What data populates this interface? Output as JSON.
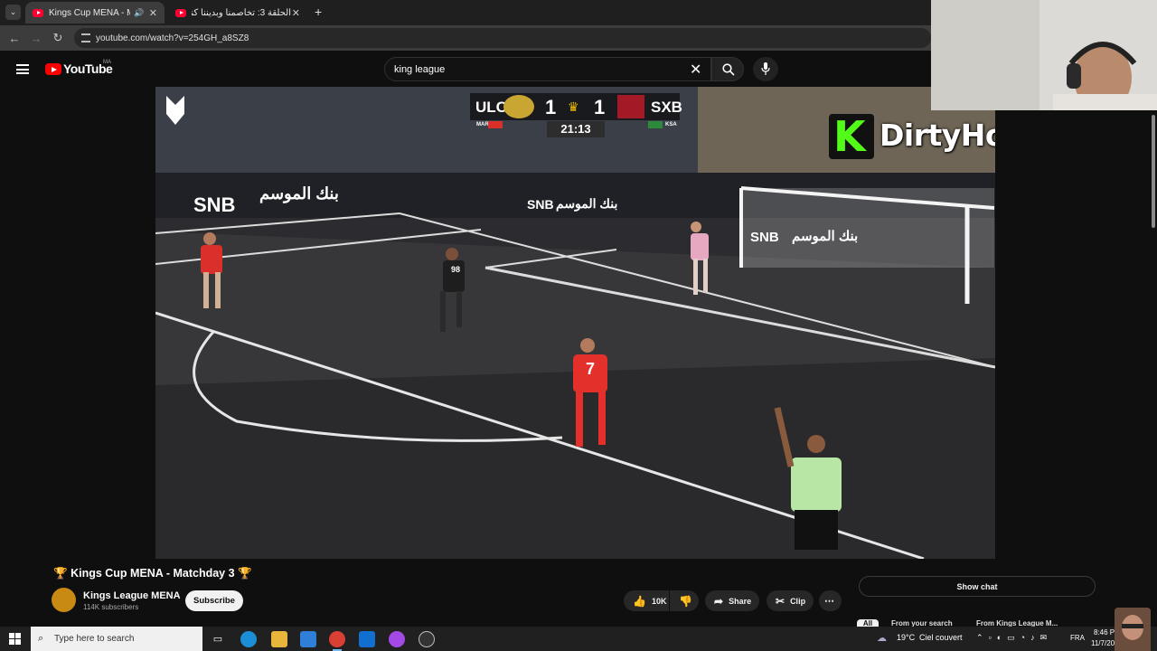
{
  "browser": {
    "tabs": [
      {
        "title": "Kings Cup MENA - Matc",
        "active": true
      },
      {
        "title": "الحلقة 3: تخاصمنا وبديننا كنضاربو",
        "active": false
      }
    ],
    "new_tab_label": "+",
    "url": "youtube.com/watch?v=254GH_a8SZ8"
  },
  "youtube": {
    "logo_text": "YouTube",
    "country_code": "MA",
    "search_value": "king league"
  },
  "video": {
    "scoreboard": {
      "home_team": "ULC",
      "home_score": "1",
      "away_team": "SXB",
      "away_score": "1",
      "clock": "21:13",
      "home_country": "MAR",
      "away_country": "KSA"
    },
    "ads": {
      "snb": "SNB",
      "arabic": "بنك الموسم"
    },
    "player_number": "7",
    "player_number_2": "98"
  },
  "stream_overlay": {
    "streamer_name": "DirtyHowaAnaa",
    "brand_color": "#53fc18"
  },
  "video_info": {
    "title": "Kings Cup MENA - Matchday 3",
    "channel": "Kings League MENA",
    "subscribers": "114K subscribers",
    "subscribe_label": "Subscribe",
    "likes": "10K",
    "share_label": "Share",
    "clip_label": "Clip",
    "show_chat_label": "Show chat",
    "chips": [
      "All",
      "From your search",
      "From Kings League M..."
    ]
  },
  "taskbar": {
    "search_placeholder": "Type here to search",
    "weather_temp": "19°C",
    "weather_desc": "Ciel couvert",
    "lang": "FRA",
    "time": "8:46 PM",
    "date": "11/7/2025"
  }
}
